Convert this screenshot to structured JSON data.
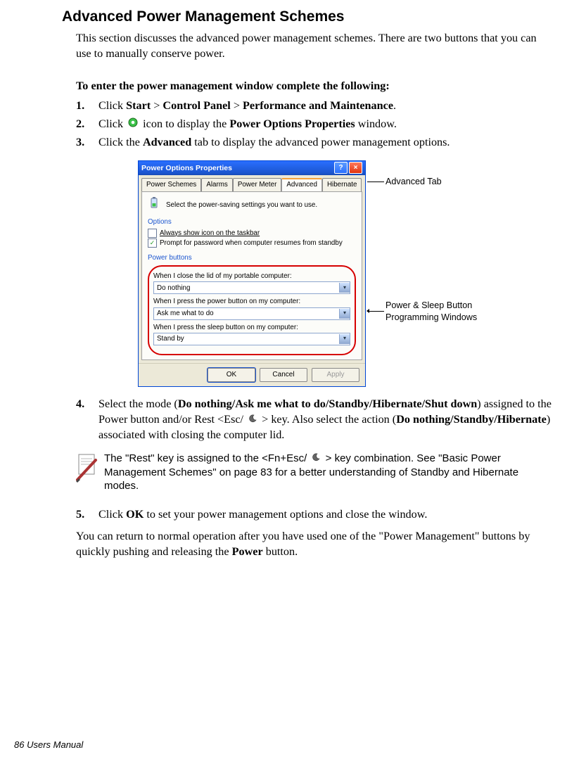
{
  "title": "Advanced Power Management Schemes",
  "intro": "This section discusses the advanced power management schemes. There are two buttons that you can use to manually conserve power.",
  "sub_heading": "To enter the power management window complete the following:",
  "steps123": {
    "n1": "1.",
    "s1a": "Click ",
    "s1b": "Start",
    "s1c": " > ",
    "s1d": "Control Panel",
    "s1e": " > ",
    "s1f": "Performance and Maintenance",
    "s1g": ".",
    "n2": "2.",
    "s2a": "Click ",
    "s2b": " icon to display the ",
    "s2c": "Power Options Properties",
    "s2d": " window.",
    "n3": "3.",
    "s3a": "Click the ",
    "s3b": "Advanced",
    "s3c": " tab to display the advanced power management options."
  },
  "callouts": {
    "advanced_tab": "Advanced Tab",
    "power_sleep": "Power  & Sleep Button Programming Windows"
  },
  "dialog": {
    "title": "Power Options Properties",
    "tabs": [
      "Power Schemes",
      "Alarms",
      "Power Meter",
      "Advanced",
      "Hibernate"
    ],
    "hint": "Select the power-saving settings you want to use.",
    "options_label": "Options",
    "opt1": "Always show icon on the taskbar",
    "opt2": "Prompt for password when computer resumes from standby",
    "pb_label": "Power buttons",
    "q1": "When I close the lid of my portable computer:",
    "a1": "Do nothing",
    "q2": "When I press the power button on my computer:",
    "a2": "Ask me what to do",
    "q3": "When I press the sleep button on my computer:",
    "a3": "Stand by",
    "btn_ok": "OK",
    "btn_cancel": "Cancel",
    "btn_apply": "Apply"
  },
  "step4": {
    "n": "4.",
    "a": "Select the mode (",
    "b": "Do nothing/Ask me what to do/Standby/Hibernate/Shut down",
    "c": ") assigned to the Power button and/or Rest <Esc/ ",
    "d": " > key. Also select the action (",
    "e": "Do nothing/Standby/Hibernate",
    "f": ") associated with closing the computer lid."
  },
  "note": {
    "a": "The \"Rest\" key is assigned to the <Fn+Esc/ ",
    "b": " > key combination. See  \"Basic Power Management Schemes\" on page 83 for a better understanding of Standby and Hibernate modes."
  },
  "step5": {
    "n": "5.",
    "a": "Click ",
    "b": "OK",
    "c": " to set your power management options and close the window."
  },
  "closing": {
    "a": "You can return to normal operation after you have used one of the \"Power Management\" buttons by quickly pushing and releasing the ",
    "b": "Power",
    "c": " button."
  },
  "footer": "86  Users Manual"
}
